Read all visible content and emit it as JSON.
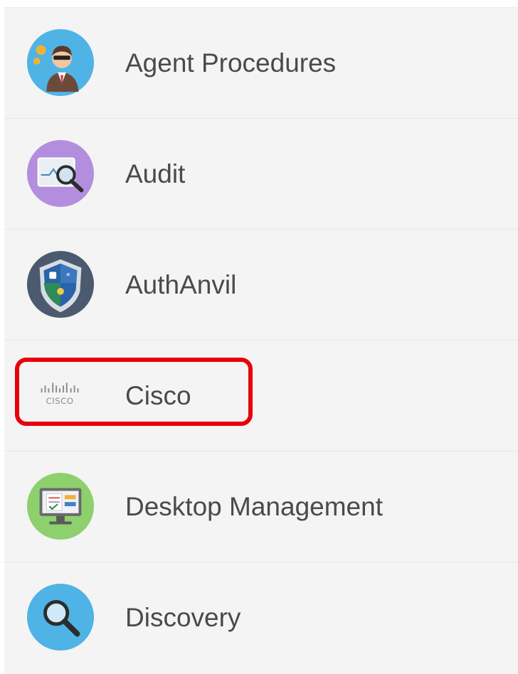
{
  "menu": {
    "items": [
      {
        "label": "Agent Procedures",
        "icon": "agent-person-icon"
      },
      {
        "label": "Audit",
        "icon": "audit-magnifier-icon"
      },
      {
        "label": "AuthAnvil",
        "icon": "authanvil-shield-icon"
      },
      {
        "label": "Cisco",
        "icon": "cisco-logo-icon"
      },
      {
        "label": "Desktop Management",
        "icon": "desktop-monitor-icon"
      },
      {
        "label": "Discovery",
        "icon": "discovery-magnifier-icon"
      }
    ],
    "selected_index": 3
  },
  "colors": {
    "highlight": "#e8000b",
    "row_background": "#f4f4f4",
    "label_text": "#4a4a4a"
  }
}
